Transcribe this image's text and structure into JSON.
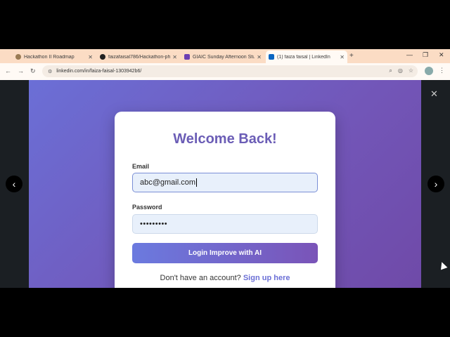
{
  "browser": {
    "tabs": [
      {
        "title": "Hackathon II Roadmap",
        "favicon_color": "#9a7b54"
      },
      {
        "title": "faizafaisal786/Hackathon-phas",
        "favicon_color": "#222222"
      },
      {
        "title": "GIAIC Sunday Afternoon Studen",
        "favicon_color": "#6b3fb3"
      },
      {
        "title": "(1) faiza faisal | LinkedIn",
        "favicon_color": "#0a66c2"
      }
    ],
    "new_tab": "+",
    "address": "linkedin.com/in/faiza-faisal-1303942b6/"
  },
  "card": {
    "title": "Welcome Back!",
    "email_label": "Email",
    "email_value": "abc@gmail.com",
    "password_label": "Password",
    "password_value": "•••••••••",
    "login_label": "Login Improve with AI",
    "signup_prompt": "Don't have an account?",
    "signup_link": "Sign up here"
  },
  "colors": {
    "accent": "#6b5db6",
    "gradient_start": "#6b6fd6",
    "gradient_end": "#7256b8"
  }
}
